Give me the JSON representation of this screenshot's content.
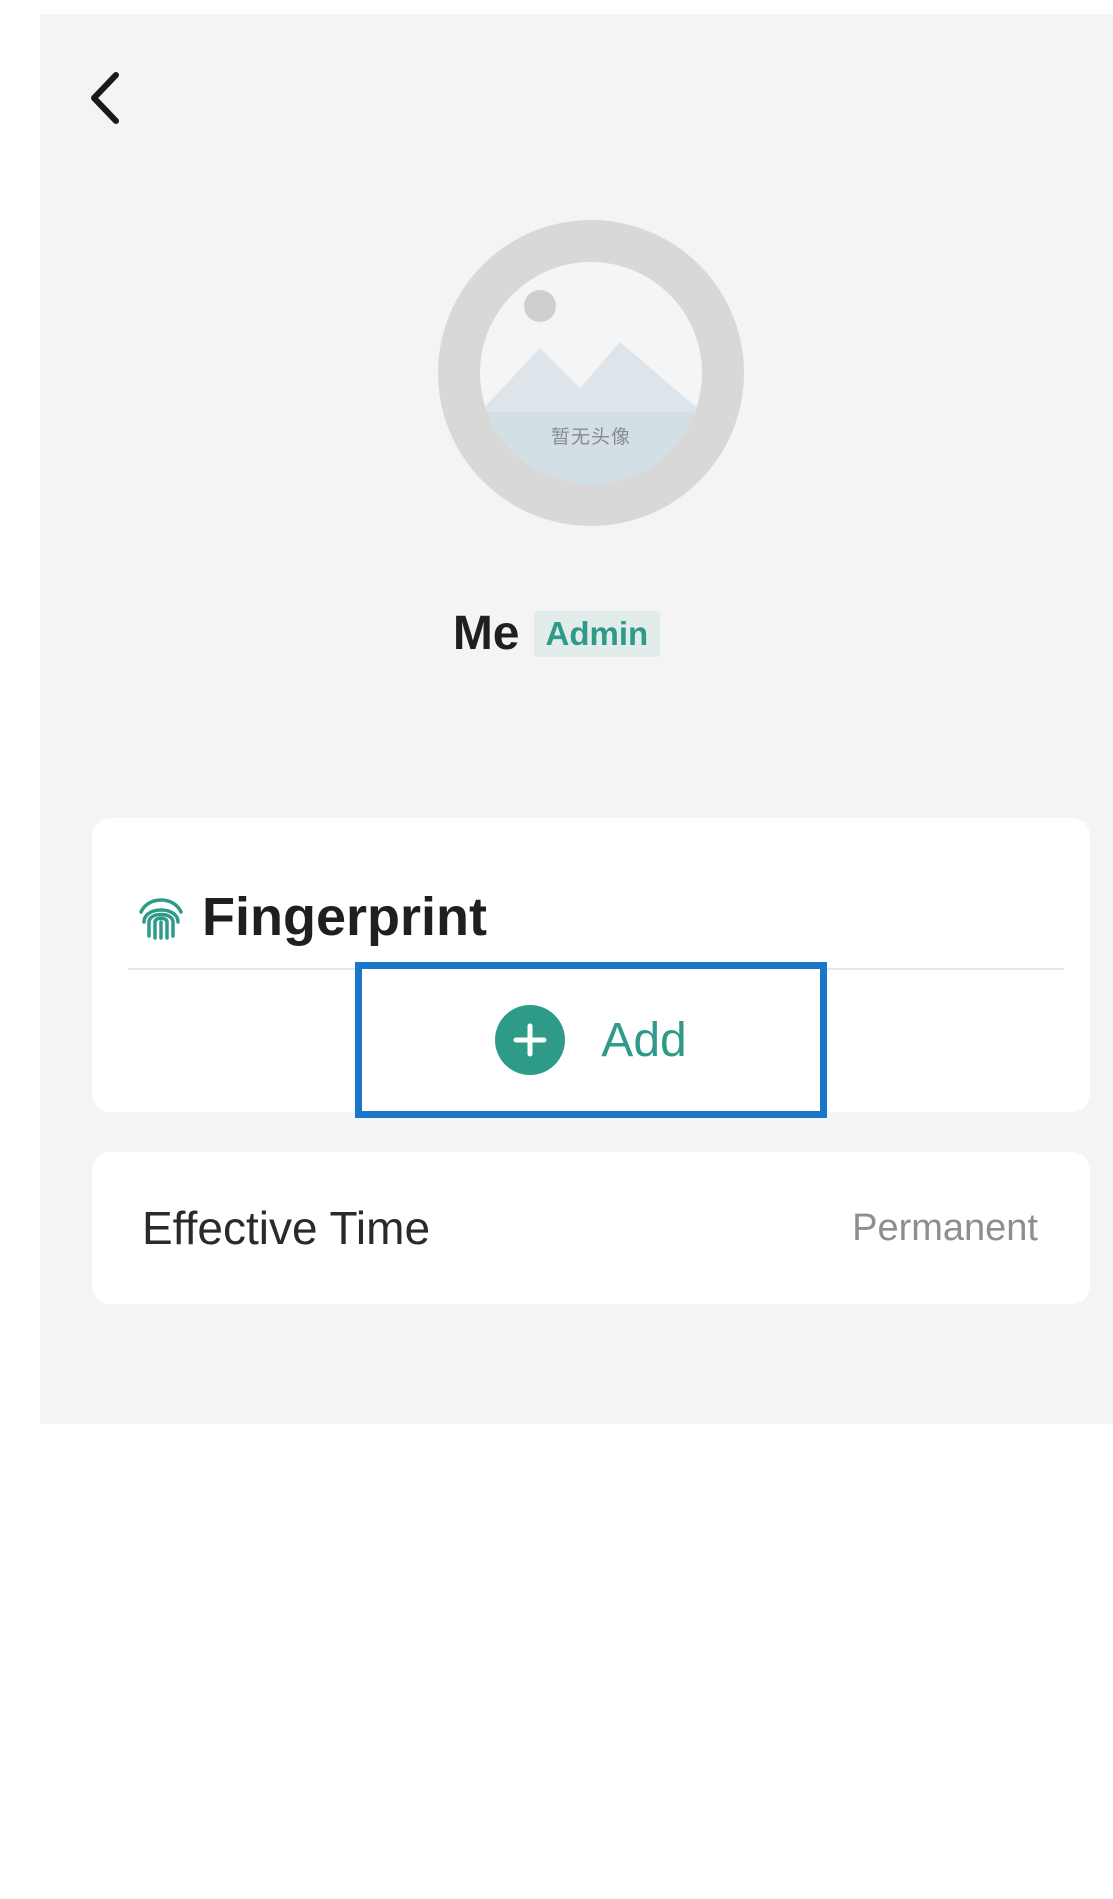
{
  "header": {
    "back_icon": "chevron-left-icon"
  },
  "profile": {
    "avatar_caption": "暂无头像",
    "name": "Me",
    "role": "Admin"
  },
  "fingerprint": {
    "icon": "fingerprint-icon",
    "title": "Fingerprint",
    "add_label": "Add",
    "add_icon": "plus-circle-icon"
  },
  "effective_time": {
    "label": "Effective Time",
    "value": "Permanent"
  },
  "colors": {
    "accent": "#2e9b88",
    "highlight_border": "#1976c9",
    "panel_bg": "#f4f4f4"
  }
}
